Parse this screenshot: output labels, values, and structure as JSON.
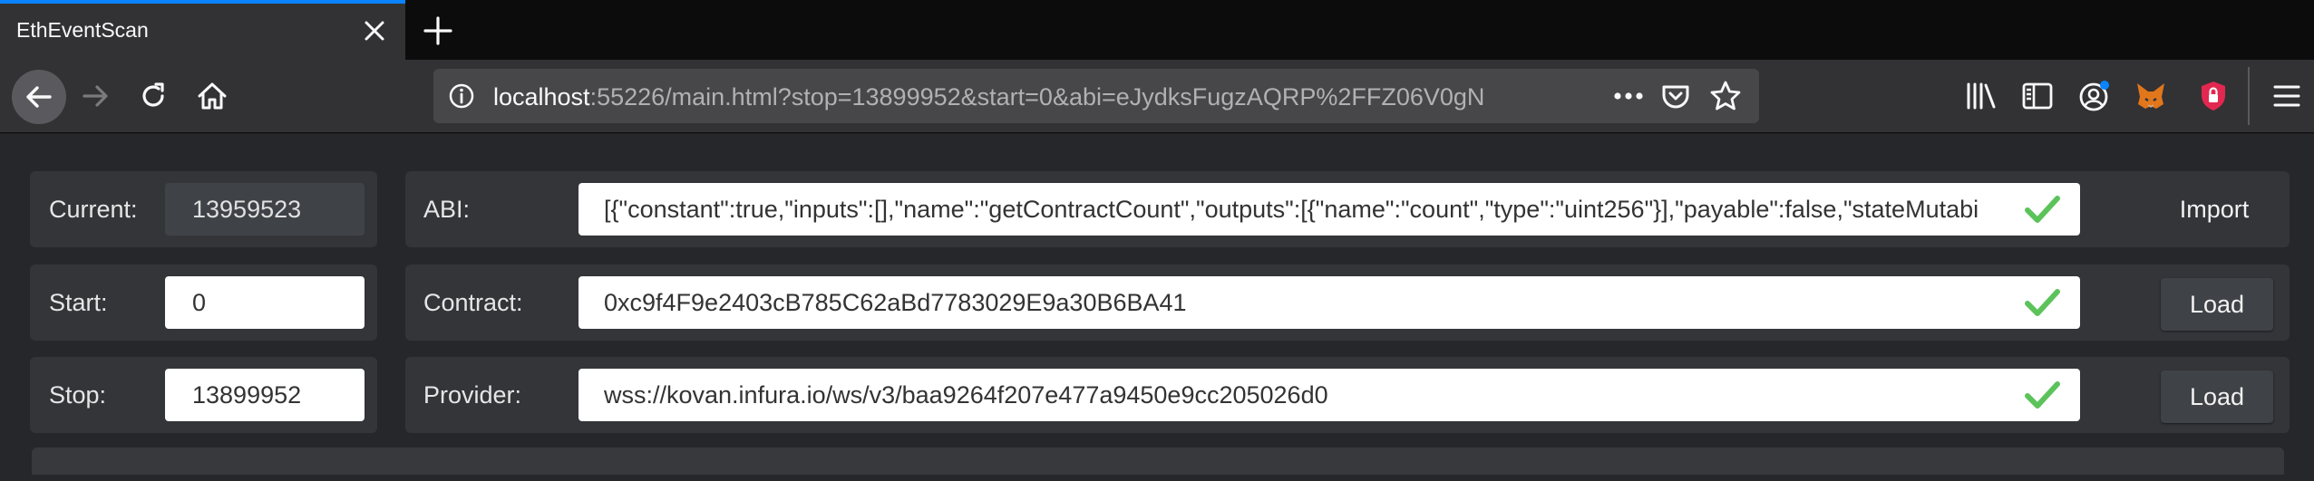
{
  "browser": {
    "tab_title": "EthEventScan",
    "url_host": "localhost",
    "url_rest": ":55226/main.html?stop=13899952&start=0&abi=eJydksFugzAQRP%2FFZ06V0gN",
    "accent_color": "#0a84ff"
  },
  "form": {
    "current": {
      "label": "Current:",
      "value": "13959523"
    },
    "start": {
      "label": "Start:",
      "value": "0"
    },
    "stop": {
      "label": "Stop:",
      "value": "13899952"
    },
    "abi": {
      "label": "ABI:",
      "value": "[{\"constant\":true,\"inputs\":[],\"name\":\"getContractCount\",\"outputs\":[{\"name\":\"count\",\"type\":\"uint256\"}],\"payable\":false,\"stateMutabi",
      "action": "Import"
    },
    "contract": {
      "label": "Contract:",
      "value": "0xc9f4F9e2403cB785C62aBd7783029E9a30B6BA41",
      "action": "Load"
    },
    "provider": {
      "label": "Provider:",
      "value": "wss://kovan.infura.io/ws/v3/baa9264f207e477a9450e9cc205026d0",
      "action": "Load"
    },
    "check_color": "#5cc35a"
  }
}
